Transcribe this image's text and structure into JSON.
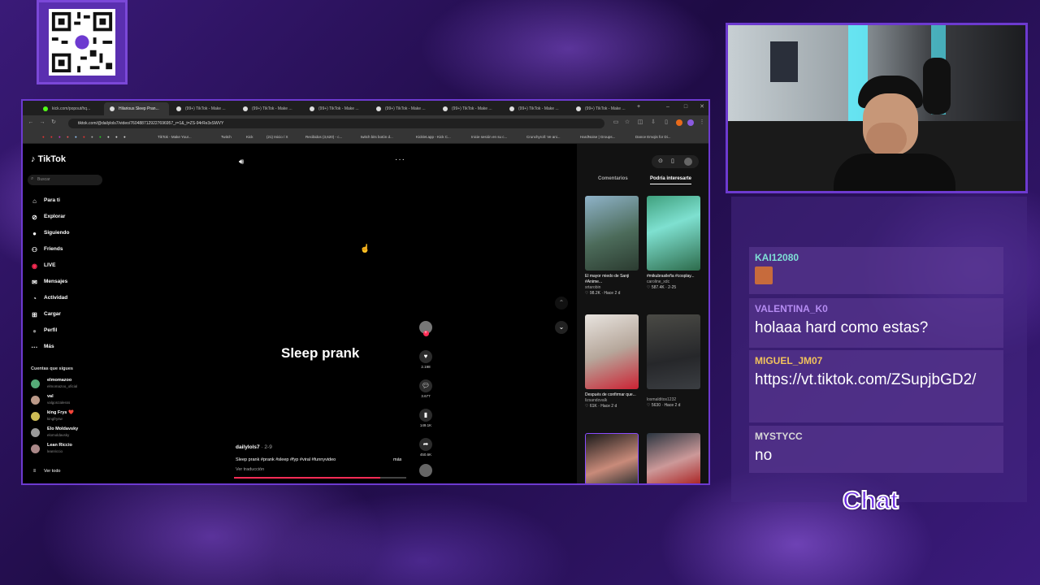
{
  "browser": {
    "tabs": [
      "kick.com/popout/hq...",
      "Hilarious Sleep Pran...",
      "(99+) TikTok - Make ...",
      "(99+) TikTok - Make ...",
      "(99+) TikTok - Make ...",
      "(99+) TikTok - Make ...",
      "(99+) TikTok - Make ...",
      "(99+) TikTok - Make ...",
      "(99+) TikTok - Make ..."
    ],
    "url": "tiktok.com/@dailylols7/video/7604887129227696957_r=1&_t=ZS-94rRe3xSWVY",
    "bookmarks": [
      "TikTok - Make Your...",
      "Twitch",
      "Kick",
      "(21) Inicio / X",
      "Recibidos (3,620) - c...",
      "twitch bits botón d...",
      "Kicklet.app - Kick C...",
      "Inicie sesión en su c...",
      "Crunchyroll: Ve ani...",
      "HardNoise | Groups...",
      "Dance Emojis for Di..."
    ]
  },
  "tiktok": {
    "logo": "TikTok",
    "search_placeholder": "Buscar",
    "nav": [
      "Para ti",
      "Explorar",
      "Siguiendo",
      "Friends",
      "LIVE",
      "Mensajes",
      "Actividad",
      "Cargar",
      "Perfil",
      "Más"
    ],
    "following_title": "Cuentas que sigues",
    "following": [
      {
        "name": "elmomazoo",
        "handle": "elmomazoo_oficial"
      },
      {
        "name": "val",
        "handle": "valgonzalesss"
      },
      {
        "name": "king Frys ❤️",
        "handle": "kingfrysw"
      },
      {
        "name": "Elo Moldavsky",
        "handle": "elomoldavsky"
      },
      {
        "name": "Lean Riccio",
        "handle": "leanriccio"
      }
    ],
    "see_all": "Ver todo",
    "video_title": "Sleep prank",
    "author": "dailylols7",
    "author_date": "· 2-9",
    "caption": "Sleep prank #prank #sleep #fyp #viral #funnyvideo",
    "more": "más",
    "translate": "Ver traducción",
    "progress": 0.85,
    "counts": {
      "likes": "2.198",
      "comments": "3.677",
      "saves": "149.1K",
      "shares": "450.6K"
    },
    "right_tabs": [
      "Comentarios",
      "Podría interesarte"
    ],
    "recs": [
      {
        "title": "El mayor miedo de Sanji #Anime...",
        "user": "srtarobin",
        "stats": "♡ 98.2K · Hace 2 d"
      },
      {
        "title": "#mikubrasileña #cosplay...",
        "user": "caroline_xdc",
        "stats": "♡ 587.4K · 2-25"
      },
      {
        "title": "Después de confirmar que...",
        "user": "lizsandovalk",
        "stats": "♡ 61K · Hace 2 d"
      },
      {
        "title": "",
        "user": "losmalditos1232",
        "stats": "♡ 5630 · Hace 2 d"
      }
    ]
  },
  "chat": {
    "label": "Chat",
    "messages": [
      {
        "user": "KAI12080",
        "user_color": "#7fe0d6",
        "text": ""
      },
      {
        "user": "VALENTINA_K0",
        "user_color": "#b58cf2",
        "text": "holaaa hard como estas?"
      },
      {
        "user": "MIGUEL_JM07",
        "user_color": "#f2c35c",
        "text": "https://vt.tiktok.com/ZSupjbGD2/"
      },
      {
        "user": "MYSTYCC",
        "user_color": "#d8d8d8",
        "text": "no"
      }
    ]
  }
}
